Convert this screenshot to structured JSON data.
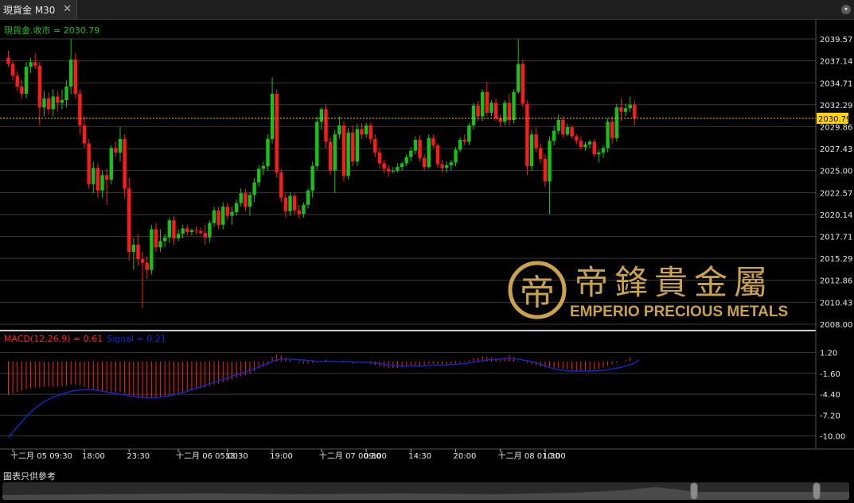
{
  "tab": {
    "title": "現貨金 M30",
    "close_icon": "close-icon"
  },
  "window_menu_icon": "chevron-down-icon",
  "footer": {
    "note": "圖表只供參考"
  },
  "logo": {
    "chinese": "帝鋒貴金屬",
    "english": "EMPERIO PRECIOUS METALS",
    "mark": "帝"
  },
  "colors": {
    "up": "#16c216",
    "down": "#ff1a1a",
    "grid": "#3a3a3a",
    "signal": "#1028d8",
    "last_price_line": "#ffd400",
    "macd_label": "#ff2020",
    "price_label": "#16c216"
  },
  "chart_data": [
    {
      "type": "candlestick",
      "legend": "現貨金.收市 = 2030.79",
      "last_price": 2030.79,
      "last_price_label": "2030.79",
      "y_ticks": [
        "2039.57",
        "2037.14",
        "2034.71",
        "2032.29",
        "2029.86",
        "2027.43",
        "2025.00",
        "2022.57",
        "2020.14",
        "2017.71",
        "2015.29",
        "2012.86",
        "2010.43",
        "2008.00"
      ],
      "ylim": [
        2008.0,
        2039.57
      ],
      "candles": [
        [
          2037.5,
          2038.3,
          2036.5,
          2036.8
        ],
        [
          2036.8,
          2037.2,
          2035.0,
          2035.5
        ],
        [
          2035.5,
          2036.0,
          2033.8,
          2034.3
        ],
        [
          2034.3,
          2035.0,
          2033.0,
          2033.5
        ],
        [
          2033.5,
          2037.0,
          2033.0,
          2036.5
        ],
        [
          2036.5,
          2037.5,
          2035.8,
          2037.0
        ],
        [
          2037.0,
          2038.0,
          2036.2,
          2036.6
        ],
        [
          2036.6,
          2037.0,
          2030.0,
          2032.0
        ],
        [
          2032.0,
          2033.8,
          2031.0,
          2033.0
        ],
        [
          2033.0,
          2033.6,
          2031.2,
          2031.8
        ],
        [
          2031.8,
          2034.0,
          2031.0,
          2033.2
        ],
        [
          2033.2,
          2033.8,
          2031.5,
          2032.5
        ],
        [
          2032.5,
          2034.0,
          2031.8,
          2032.8
        ],
        [
          2032.8,
          2035.0,
          2032.0,
          2034.3
        ],
        [
          2034.3,
          2039.6,
          2033.5,
          2037.3
        ],
        [
          2037.3,
          2038.0,
          2033.0,
          2033.5
        ],
        [
          2033.5,
          2034.0,
          2029.0,
          2030.0
        ],
        [
          2030.0,
          2031.0,
          2027.5,
          2028.0
        ],
        [
          2028.0,
          2028.5,
          2023.0,
          2023.5
        ],
        [
          2023.5,
          2026.0,
          2022.5,
          2025.3
        ],
        [
          2025.3,
          2025.8,
          2022.0,
          2022.8
        ],
        [
          2022.8,
          2025.0,
          2022.0,
          2024.5
        ],
        [
          2024.5,
          2025.2,
          2021.2,
          2024.0
        ],
        [
          2024.0,
          2027.8,
          2023.5,
          2027.5
        ],
        [
          2027.5,
          2028.2,
          2026.5,
          2027.0
        ],
        [
          2027.0,
          2029.8,
          2026.0,
          2028.5
        ],
        [
          2028.5,
          2029.0,
          2022.0,
          2023.0
        ],
        [
          2023.0,
          2024.2,
          2015.0,
          2016.0
        ],
        [
          2016.0,
          2017.5,
          2014.0,
          2016.8
        ],
        [
          2016.8,
          2018.0,
          2014.5,
          2015.2
        ],
        [
          2015.2,
          2016.0,
          2009.8,
          2014.8
        ],
        [
          2014.8,
          2015.5,
          2013.0,
          2014.0
        ],
        [
          2014.0,
          2019.0,
          2013.5,
          2018.5
        ],
        [
          2018.5,
          2019.2,
          2016.0,
          2016.5
        ],
        [
          2016.5,
          2018.5,
          2016.0,
          2017.2
        ],
        [
          2017.2,
          2018.0,
          2016.5,
          2017.6
        ],
        [
          2017.6,
          2019.8,
          2017.0,
          2019.5
        ],
        [
          2019.5,
          2020.0,
          2016.8,
          2017.5
        ],
        [
          2017.5,
          2018.5,
          2017.2,
          2018.0
        ],
        [
          2018.0,
          2019.0,
          2017.5,
          2018.6
        ],
        [
          2018.6,
          2019.0,
          2017.8,
          2018.2
        ],
        [
          2018.2,
          2018.6,
          2017.8,
          2018.4
        ],
        [
          2018.4,
          2018.8,
          2018.0,
          2018.3
        ],
        [
          2018.3,
          2018.7,
          2017.9,
          2018.1
        ],
        [
          2018.1,
          2019.0,
          2016.8,
          2017.6
        ],
        [
          2017.6,
          2019.5,
          2017.0,
          2019.2
        ],
        [
          2019.2,
          2021.0,
          2018.8,
          2020.6
        ],
        [
          2020.6,
          2021.0,
          2018.5,
          2019.0
        ],
        [
          2019.0,
          2021.5,
          2018.5,
          2021.0
        ],
        [
          2021.0,
          2021.5,
          2019.5,
          2020.0
        ],
        [
          2020.0,
          2021.0,
          2019.0,
          2020.4
        ],
        [
          2020.4,
          2021.8,
          2020.0,
          2021.4
        ],
        [
          2021.4,
          2023.0,
          2021.0,
          2022.5
        ],
        [
          2022.5,
          2023.0,
          2020.5,
          2021.0
        ],
        [
          2021.0,
          2022.6,
          2020.0,
          2022.3
        ],
        [
          2022.3,
          2024.2,
          2021.5,
          2023.7
        ],
        [
          2023.7,
          2025.6,
          2023.2,
          2025.2
        ],
        [
          2025.2,
          2026.0,
          2024.5,
          2025.5
        ],
        [
          2025.5,
          2029.0,
          2025.0,
          2028.5
        ],
        [
          2028.5,
          2035.3,
          2028.0,
          2033.5
        ],
        [
          2033.5,
          2034.0,
          2024.2,
          2024.8
        ],
        [
          2024.8,
          2025.2,
          2021.5,
          2022.0
        ],
        [
          2022.0,
          2022.6,
          2019.8,
          2020.5
        ],
        [
          2020.5,
          2022.6,
          2020.0,
          2022.2
        ],
        [
          2022.2,
          2022.5,
          2020.2,
          2020.6
        ],
        [
          2020.6,
          2021.2,
          2019.7,
          2020.2
        ],
        [
          2020.2,
          2021.5,
          2019.8,
          2021.2
        ],
        [
          2021.2,
          2023.0,
          2020.8,
          2022.8
        ],
        [
          2022.8,
          2026.0,
          2022.0,
          2025.5
        ],
        [
          2025.5,
          2031.0,
          2025.0,
          2030.4
        ],
        [
          2030.4,
          2032.0,
          2029.5,
          2031.8
        ],
        [
          2031.8,
          2032.3,
          2027.5,
          2028.2
        ],
        [
          2028.2,
          2028.7,
          2024.5,
          2025.0
        ],
        [
          2025.0,
          2029.5,
          2022.5,
          2029.0
        ],
        [
          2029.0,
          2031.0,
          2028.5,
          2030.0
        ],
        [
          2030.0,
          2030.5,
          2023.8,
          2024.4
        ],
        [
          2024.4,
          2029.7,
          2024.0,
          2029.2
        ],
        [
          2029.2,
          2030.0,
          2025.5,
          2026.0
        ],
        [
          2026.0,
          2030.2,
          2025.5,
          2029.6
        ],
        [
          2029.6,
          2030.2,
          2028.5,
          2029.0
        ],
        [
          2029.0,
          2030.3,
          2028.6,
          2030.0
        ],
        [
          2030.0,
          2030.3,
          2028.0,
          2028.5
        ],
        [
          2028.5,
          2029.0,
          2026.5,
          2027.0
        ],
        [
          2027.0,
          2027.5,
          2025.2,
          2025.8
        ],
        [
          2025.8,
          2026.2,
          2024.7,
          2025.2
        ],
        [
          2025.2,
          2025.6,
          2024.3,
          2024.9
        ],
        [
          2024.9,
          2025.4,
          2024.7,
          2025.0
        ],
        [
          2025.0,
          2025.8,
          2024.8,
          2025.4
        ],
        [
          2025.4,
          2026.0,
          2025.0,
          2025.8
        ],
        [
          2025.8,
          2026.8,
          2025.5,
          2026.5
        ],
        [
          2026.5,
          2027.6,
          2026.0,
          2027.2
        ],
        [
          2027.2,
          2028.8,
          2026.8,
          2028.4
        ],
        [
          2028.4,
          2028.9,
          2026.0,
          2026.4
        ],
        [
          2026.4,
          2026.8,
          2025.0,
          2025.4
        ],
        [
          2025.4,
          2029.0,
          2025.2,
          2028.6
        ],
        [
          2028.6,
          2029.0,
          2027.5,
          2027.8
        ],
        [
          2027.8,
          2028.0,
          2025.3,
          2025.7
        ],
        [
          2025.7,
          2026.2,
          2024.8,
          2025.3
        ],
        [
          2025.3,
          2026.0,
          2024.8,
          2025.6
        ],
        [
          2025.6,
          2026.2,
          2025.0,
          2025.9
        ],
        [
          2025.9,
          2027.6,
          2025.5,
          2027.3
        ],
        [
          2027.3,
          2028.7,
          2027.0,
          2028.4
        ],
        [
          2028.4,
          2029.0,
          2027.8,
          2028.2
        ],
        [
          2028.2,
          2030.3,
          2027.8,
          2030.0
        ],
        [
          2030.0,
          2032.5,
          2029.5,
          2032.2
        ],
        [
          2032.2,
          2032.7,
          2030.5,
          2031.0
        ],
        [
          2031.0,
          2034.0,
          2030.5,
          2033.7
        ],
        [
          2033.7,
          2034.8,
          2031.0,
          2031.4
        ],
        [
          2031.4,
          2032.8,
          2031.0,
          2032.5
        ],
        [
          2032.5,
          2033.0,
          2030.5,
          2030.8
        ],
        [
          2030.8,
          2031.2,
          2029.8,
          2030.4
        ],
        [
          2030.4,
          2032.8,
          2030.0,
          2032.5
        ],
        [
          2032.5,
          2033.5,
          2030.0,
          2030.6
        ],
        [
          2030.6,
          2034.0,
          2030.2,
          2033.7
        ],
        [
          2033.7,
          2039.6,
          2033.5,
          2036.8
        ],
        [
          2036.8,
          2037.3,
          2032.0,
          2032.4
        ],
        [
          2032.4,
          2032.8,
          2024.5,
          2025.5
        ],
        [
          2025.5,
          2029.5,
          2025.0,
          2029.0
        ],
        [
          2029.0,
          2029.8,
          2027.0,
          2027.5
        ],
        [
          2027.5,
          2028.0,
          2025.8,
          2026.3
        ],
        [
          2026.3,
          2026.8,
          2023.2,
          2023.8
        ],
        [
          2023.8,
          2028.8,
          2020.2,
          2028.3
        ],
        [
          2028.3,
          2030.0,
          2027.8,
          2029.4
        ],
        [
          2029.4,
          2031.2,
          2029.0,
          2030.6
        ],
        [
          2030.6,
          2031.0,
          2028.6,
          2029.0
        ],
        [
          2029.0,
          2030.2,
          2028.8,
          2029.8
        ],
        [
          2029.8,
          2030.0,
          2028.5,
          2028.8
        ],
        [
          2028.8,
          2029.0,
          2027.9,
          2028.3
        ],
        [
          2028.3,
          2028.8,
          2027.3,
          2027.6
        ],
        [
          2027.6,
          2028.2,
          2027.2,
          2027.9
        ],
        [
          2027.9,
          2028.4,
          2027.5,
          2028.2
        ],
        [
          2028.2,
          2028.5,
          2026.5,
          2026.8
        ],
        [
          2026.8,
          2027.3,
          2025.9,
          2027.0
        ],
        [
          2027.0,
          2027.8,
          2026.4,
          2027.5
        ],
        [
          2027.5,
          2030.8,
          2027.0,
          2030.4
        ],
        [
          2030.4,
          2031.0,
          2028.0,
          2028.6
        ],
        [
          2028.6,
          2032.4,
          2028.2,
          2032.0
        ],
        [
          2032.0,
          2033.0,
          2030.5,
          2031.5
        ],
        [
          2031.5,
          2032.4,
          2031.0,
          2031.9
        ],
        [
          2031.9,
          2033.2,
          2031.5,
          2032.3
        ],
        [
          2032.3,
          2032.8,
          2030.0,
          2030.8
        ]
      ],
      "x_ticks": [
        {
          "i": 1,
          "label": "十二月 05 09:30"
        },
        {
          "i": 17,
          "label": "18:00"
        },
        {
          "i": 27,
          "label": "23:30"
        },
        {
          "i": 38,
          "label": "十二月 06 05:00"
        },
        {
          "i": 49,
          "label": "13:30"
        },
        {
          "i": 59,
          "label": "19:00"
        },
        {
          "i": 70,
          "label": "十二月 07 00:30"
        },
        {
          "i": 80,
          "label": "09:00"
        },
        {
          "i": 90,
          "label": "14:30"
        },
        {
          "i": 100,
          "label": "20:00"
        },
        {
          "i": 110,
          "label": "十二月 08 01:30"
        },
        {
          "i": 120,
          "label": "10:00"
        }
      ]
    },
    {
      "type": "bar+line",
      "legend_macd": "MACD(12,26,9) = 0.61",
      "legend_signal": "Signal = 0.21",
      "y_ticks": [
        "1.20",
        "-1.60",
        "-4.40",
        "-7.20",
        "-10.00"
      ],
      "ylim": [
        -10.9,
        1.8
      ],
      "macd": [
        -4.5,
        -4.3,
        -4.1,
        -3.9,
        -3.7,
        -3.6,
        -3.5,
        -3.5,
        -3.4,
        -3.4,
        -3.4,
        -3.4,
        -3.3,
        -3.2,
        -3.1,
        -3.1,
        -3.2,
        -3.4,
        -3.6,
        -3.7,
        -3.9,
        -4.0,
        -4.1,
        -4.1,
        -4.1,
        -4.1,
        -4.3,
        -4.5,
        -4.7,
        -4.9,
        -5.0,
        -5.0,
        -4.9,
        -4.8,
        -4.7,
        -4.6,
        -4.5,
        -4.4,
        -4.3,
        -4.2,
        -4.0,
        -3.9,
        -3.7,
        -3.6,
        -3.5,
        -3.3,
        -3.1,
        -3.0,
        -2.8,
        -2.6,
        -2.4,
        -2.2,
        -2.0,
        -1.8,
        -1.6,
        -1.3,
        -1.0,
        -0.7,
        -0.3,
        0.6,
        1.0,
        0.8,
        0.5,
        0.2,
        0.0,
        -0.2,
        -0.3,
        -0.3,
        -0.2,
        -0.1,
        0.1,
        0.2,
        0.1,
        -0.1,
        0.0,
        -0.2,
        -0.1,
        -0.3,
        -0.2,
        -0.2,
        -0.2,
        -0.3,
        -0.5,
        -0.7,
        -0.8,
        -0.9,
        -0.9,
        -0.9,
        -0.8,
        -0.7,
        -0.6,
        -0.5,
        -0.5,
        -0.5,
        -0.3,
        -0.3,
        -0.4,
        -0.5,
        -0.5,
        -0.4,
        -0.3,
        -0.2,
        -0.1,
        0.2,
        0.4,
        0.5,
        0.7,
        0.6,
        0.5,
        0.4,
        0.3,
        0.5,
        0.9,
        0.6,
        0.1,
        0.0,
        -0.2,
        -0.4,
        -0.5,
        -0.7,
        -0.8,
        -0.8,
        -0.9,
        -0.9,
        -1.0,
        -1.1,
        -1.1,
        -1.2,
        -1.2,
        -1.2,
        -1.2,
        -1.1,
        -1.0,
        -0.8,
        -0.6,
        -0.4,
        -0.2,
        0.0,
        0.2,
        0.6
      ],
      "signal": [
        -10.2,
        -9.5,
        -8.8,
        -8.1,
        -7.4,
        -6.8,
        -6.3,
        -5.8,
        -5.4,
        -5.1,
        -4.8,
        -4.6,
        -4.4,
        -4.2,
        -4.0,
        -3.9,
        -3.8,
        -3.8,
        -3.8,
        -3.8,
        -3.9,
        -4.0,
        -4.1,
        -4.2,
        -4.3,
        -4.4,
        -4.5,
        -4.6,
        -4.7,
        -4.8,
        -4.8,
        -4.9,
        -4.9,
        -4.9,
        -4.8,
        -4.7,
        -4.6,
        -4.5,
        -4.3,
        -4.2,
        -4.0,
        -3.8,
        -3.6,
        -3.4,
        -3.2,
        -3.0,
        -2.8,
        -2.6,
        -2.4,
        -2.2,
        -2.0,
        -1.8,
        -1.6,
        -1.4,
        -1.2,
        -1.0,
        -0.7,
        -0.5,
        -0.3,
        0.0,
        0.2,
        0.3,
        0.3,
        0.3,
        0.3,
        0.2,
        0.2,
        0.1,
        0.1,
        0.0,
        0.0,
        0.0,
        0.0,
        0.0,
        0.0,
        0.0,
        0.0,
        -0.1,
        -0.1,
        -0.1,
        -0.1,
        -0.2,
        -0.2,
        -0.3,
        -0.4,
        -0.5,
        -0.5,
        -0.6,
        -0.6,
        -0.6,
        -0.6,
        -0.6,
        -0.6,
        -0.6,
        -0.5,
        -0.5,
        -0.5,
        -0.5,
        -0.5,
        -0.4,
        -0.4,
        -0.3,
        -0.3,
        -0.2,
        -0.1,
        0.0,
        0.1,
        0.2,
        0.3,
        0.3,
        0.3,
        0.4,
        0.4,
        0.4,
        0.3,
        0.2,
        0.1,
        0.0,
        -0.2,
        -0.4,
        -0.6,
        -0.8,
        -1.0,
        -1.1,
        -1.2,
        -1.3,
        -1.3,
        -1.3,
        -1.3,
        -1.3,
        -1.3,
        -1.3,
        -1.2,
        -1.2,
        -1.1,
        -1.0,
        -0.9,
        -0.8,
        -0.6,
        -0.4,
        -0.2,
        0.2
      ]
    }
  ]
}
